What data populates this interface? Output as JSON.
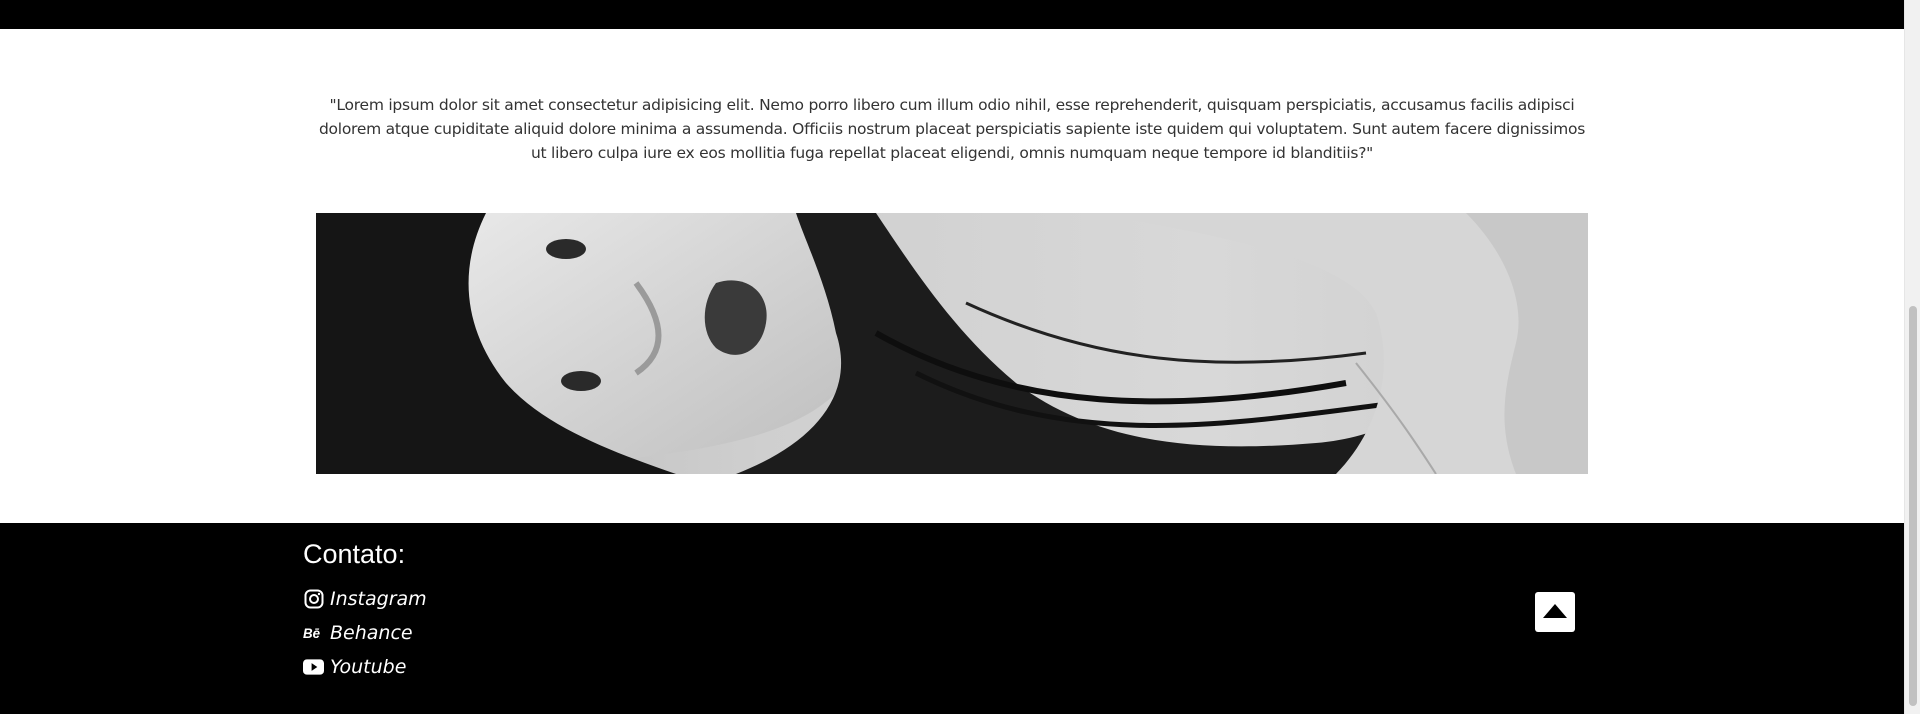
{
  "quote": {
    "text": "\"Lorem ipsum dolor sit amet consectetur adipisicing elit. Nemo porro libero cum illum odio nihil, esse reprehenderit, quisquam perspiciatis, accusamus facilis adipisci dolorem atque cupiditate aliquid dolore minima a assumenda. Officiis nostrum placeat perspiciatis sapiente iste quidem qui voluptatem. Sunt autem facere dignissimos ut libero culpa iure ex eos mollitia fuga repellat placeat eligendi, omnis numquam neque tempore id blanditiis?\""
  },
  "footer": {
    "title": "Contato:",
    "links": [
      {
        "label": "Instagram",
        "icon": "instagram-icon"
      },
      {
        "label": "Behance",
        "icon": "behance-icon"
      },
      {
        "label": "Youtube",
        "icon": "youtube-icon"
      }
    ],
    "back_to_top_icon": "caret-up-icon"
  },
  "colors": {
    "background": "#ffffff",
    "bars": "#000000",
    "text": "#333333",
    "footer_text": "#ffffff"
  }
}
